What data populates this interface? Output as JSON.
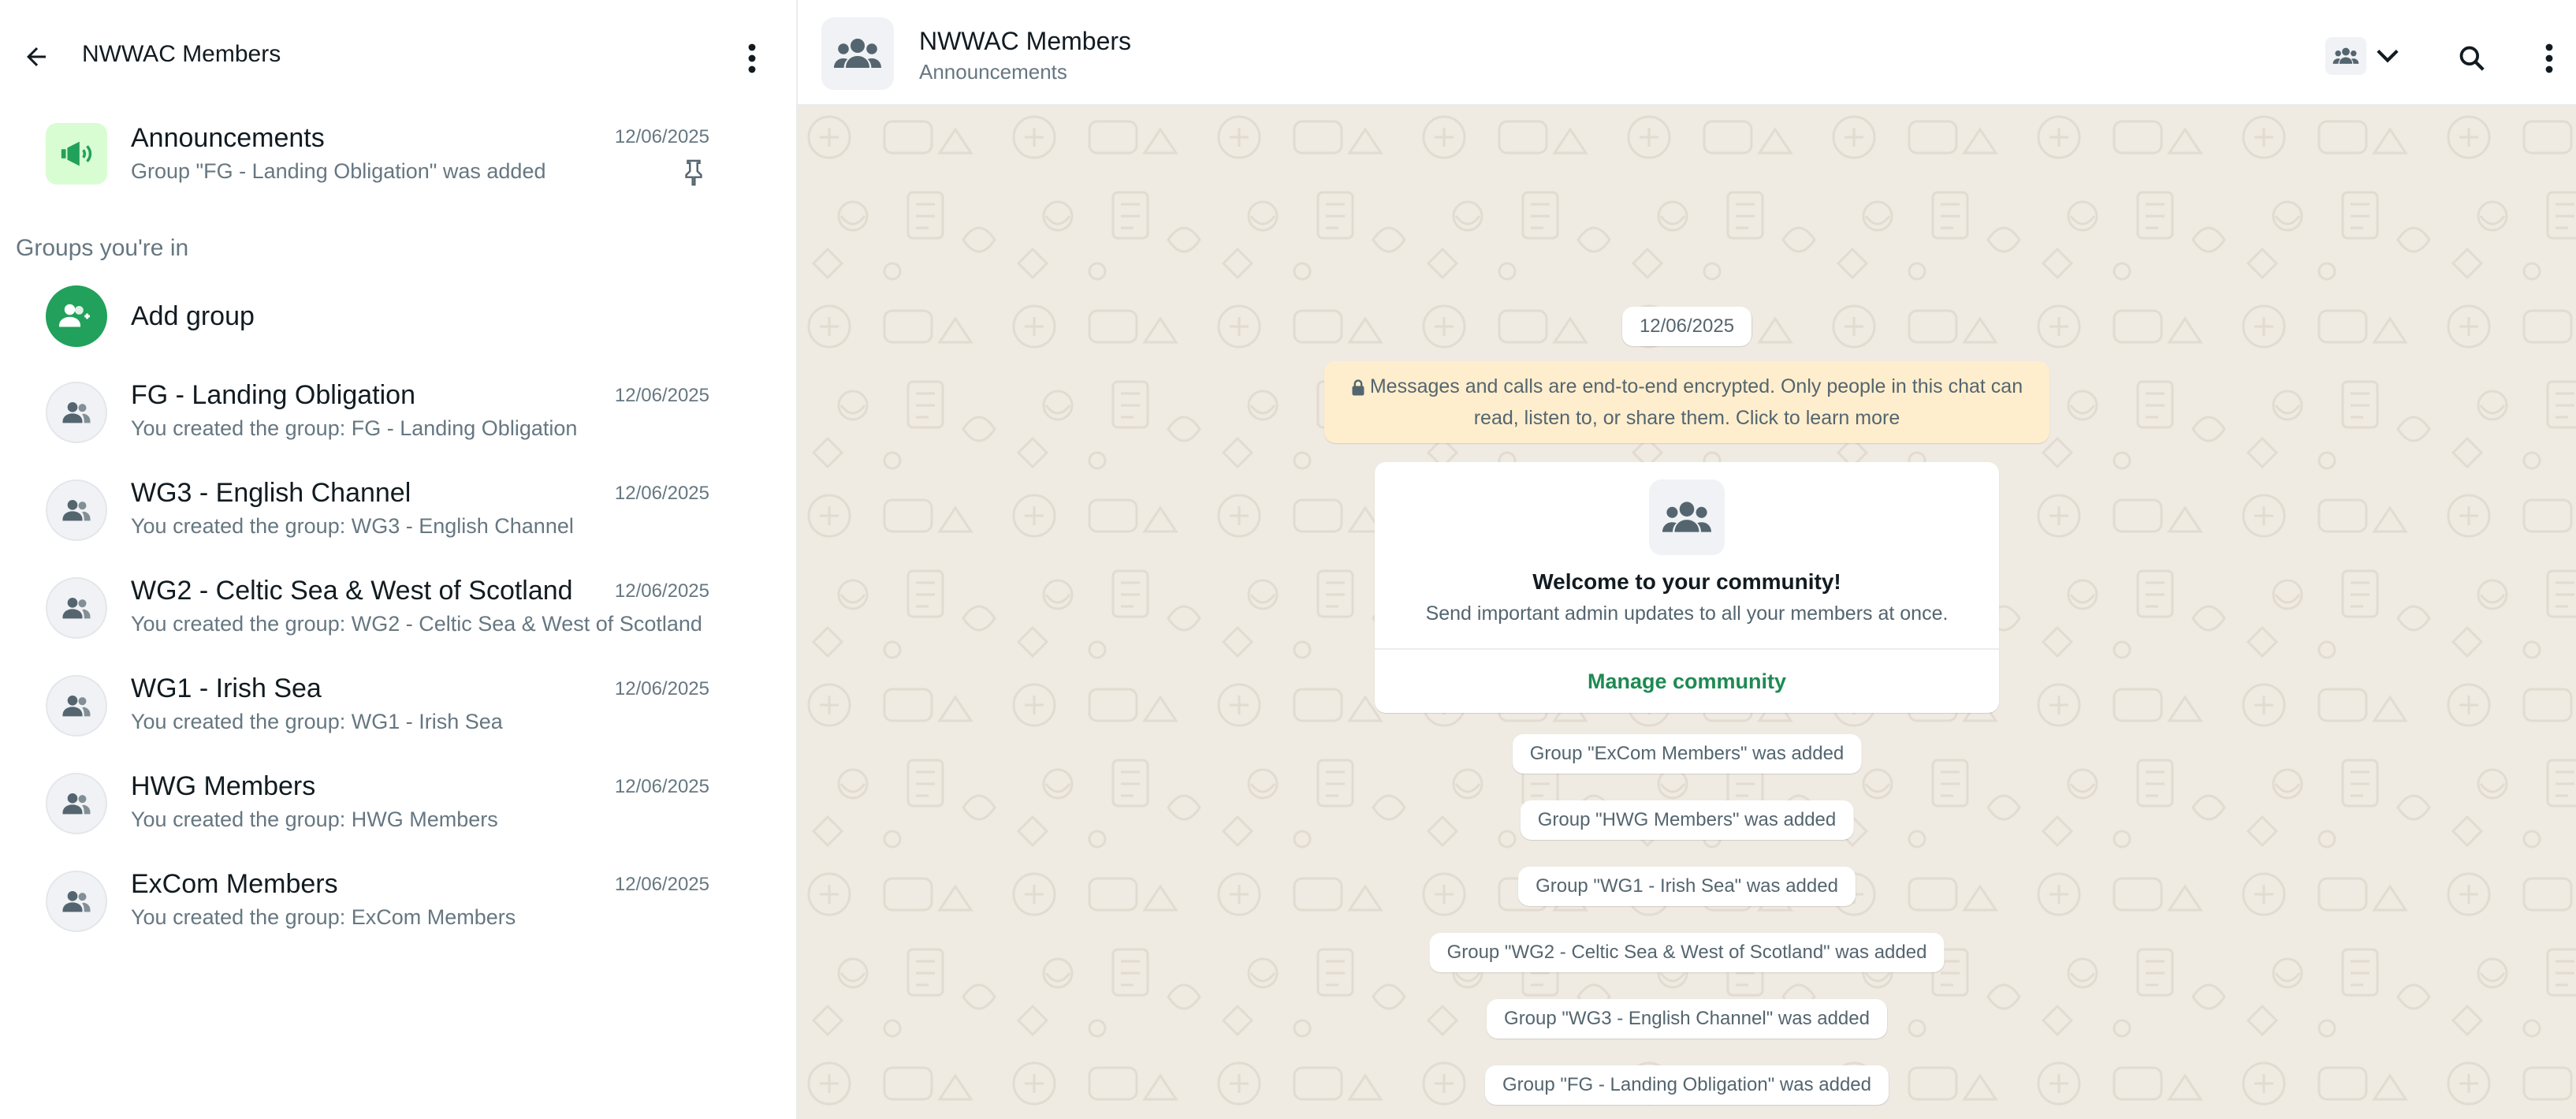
{
  "sidebar": {
    "title": "NWWAC Members",
    "announcements": {
      "title": "Announcements",
      "subtitle": "Group \"FG - Landing Obligation\" was added",
      "date": "12/06/2025"
    },
    "section_label": "Groups you're in",
    "add_group_label": "Add group",
    "groups": [
      {
        "title": "FG - Landing Obligation",
        "subtitle": "You created the group: FG - Landing Obligation",
        "date": "12/06/2025"
      },
      {
        "title": "WG3 - English Channel",
        "subtitle": "You created the group: WG3 - English Channel",
        "date": "12/06/2025"
      },
      {
        "title": "WG2 - Celtic Sea & West of Scotland",
        "subtitle": "You created the group: WG2 - Celtic Sea & West of Scotland",
        "date": "12/06/2025"
      },
      {
        "title": "WG1 - Irish Sea",
        "subtitle": "You created the group: WG1 - Irish Sea",
        "date": "12/06/2025"
      },
      {
        "title": "HWG Members",
        "subtitle": "You created the group: HWG Members",
        "date": "12/06/2025"
      },
      {
        "title": "ExCom Members",
        "subtitle": "You created the group: ExCom Members",
        "date": "12/06/2025"
      }
    ]
  },
  "chat": {
    "header_title": "NWWAC Members",
    "header_subtitle": "Announcements",
    "date_separator": "12/06/2025",
    "encryption_notice": "Messages and calls are end-to-end encrypted. Only people in this chat can read, listen to, or share them. Click to learn more",
    "welcome": {
      "title": "Welcome to your community!",
      "subtitle": "Send important admin updates to all your members at once.",
      "action": "Manage community"
    },
    "system_messages": [
      "Group \"ExCom Members\" was added",
      "Group \"HWG Members\" was added",
      "Group \"WG1 - Irish Sea\" was added",
      "Group \"WG2 - Celtic Sea & West of Scotland\" was added",
      "Group \"WG3 - English Channel\" was added",
      "Group \"FG - Landing Obligation\" was added"
    ]
  },
  "colors": {
    "accent_green": "#21a15b",
    "manage_text": "#1e8a53",
    "chat_background": "#efeae2",
    "encryption_bg": "#ffeecd"
  },
  "icons": {
    "back": "arrow-left-icon",
    "menu": "kebab-menu-icon",
    "announcement": "megaphone-icon",
    "pin": "pin-icon",
    "add_group": "add-group-icon",
    "group": "group-icon",
    "community": "community-icon",
    "chevron": "chevron-down-icon",
    "search": "search-icon",
    "lock": "lock-icon"
  }
}
